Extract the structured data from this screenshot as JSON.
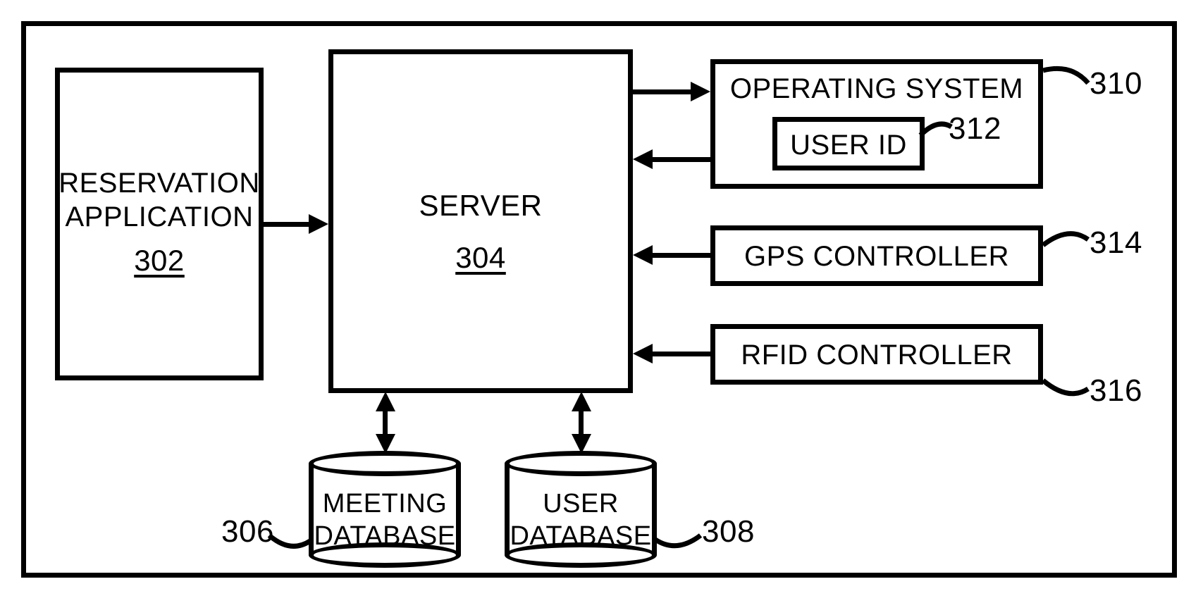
{
  "frame": {},
  "blocks": {
    "reservation": {
      "line1": "RESERVATION",
      "line2": "APPLICATION",
      "ref": "302"
    },
    "server": {
      "label": "SERVER",
      "ref": "304"
    },
    "os": {
      "label": "OPERATING SYSTEM",
      "ref": "310"
    },
    "userid": {
      "label": "USER ID",
      "ref": "312"
    },
    "gps": {
      "label": "GPS CONTROLLER",
      "ref": "314"
    },
    "rfid": {
      "label": "RFID CONTROLLER",
      "ref": "316"
    }
  },
  "db": {
    "meeting": {
      "line1": "MEETING",
      "line2": "DATABASE",
      "ref": "306"
    },
    "user": {
      "line1": "USER",
      "line2": "DATABASE",
      "ref": "308"
    }
  }
}
